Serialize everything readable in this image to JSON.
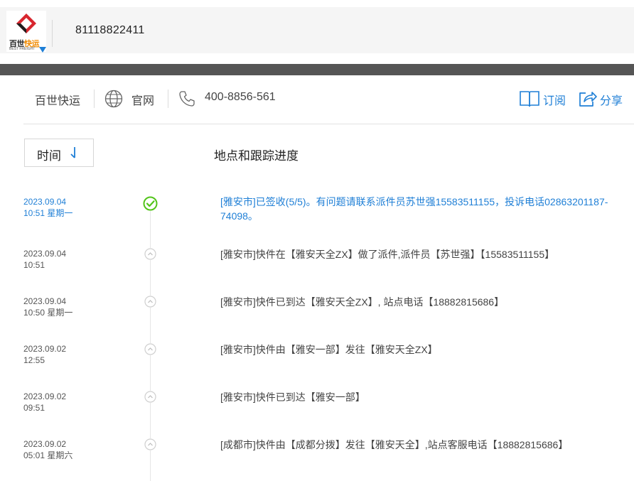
{
  "header": {
    "logo_name_black": "百世",
    "logo_name_orange": "快运",
    "logo_sub": "BEST FREIGHT",
    "tracking_number": "81118822411"
  },
  "info_bar": {
    "carrier": "百世快运",
    "website_label": "官网",
    "phone": "400-8856-561",
    "subscribe_label": "订阅",
    "share_label": "分享"
  },
  "table": {
    "time_header": "时间",
    "sort_icon": "sort-down-arrow",
    "progress_header": "地点和跟踪进度"
  },
  "events": [
    {
      "date": "2023.09.04",
      "time": "10:51 星期一",
      "text": "[雅安市]已签收(5/5)。有问题请联系派件员苏世强15583511155，投诉电话02863201187-74098。",
      "status": "delivered"
    },
    {
      "date": "2023.09.04",
      "time": "10:51",
      "text": "[雅安市]快件在【雅安天全ZX】做了派件,派件员【苏世强】【15583511155】",
      "status": "transit"
    },
    {
      "date": "2023.09.04",
      "time": "10:50 星期一",
      "text": "[雅安市]快件已到达【雅安天全ZX】, 站点电话【18882815686】",
      "status": "transit"
    },
    {
      "date": "2023.09.02",
      "time": "12:55",
      "text": "[雅安市]快件由【雅安一部】发往【雅安天全ZX】",
      "status": "transit"
    },
    {
      "date": "2023.09.02",
      "time": "09:51",
      "text": "[雅安市]快件已到达【雅安一部】",
      "status": "transit"
    },
    {
      "date": "2023.09.02",
      "time": "05:01 星期六",
      "text": "[成都市]快件由【成都分拨】发往【雅安天全】,站点客服电话【18882815686】",
      "status": "transit"
    }
  ],
  "colors": {
    "accent": "#1f7fd6",
    "delivered": "#52c41a",
    "dark_bar": "#555555",
    "logo_red": "#d8262e",
    "logo_orange": "#f08a00"
  }
}
